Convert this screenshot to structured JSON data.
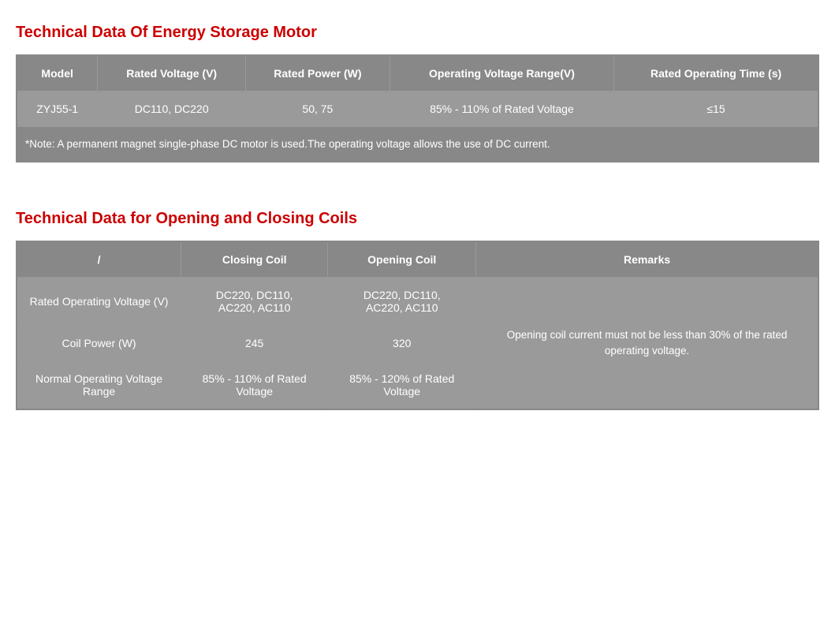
{
  "section1": {
    "title": "Technical Data Of Energy Storage Motor",
    "table": {
      "headers": [
        "Model",
        "Rated Voltage (V)",
        "Rated Power (W)",
        "Operating Voltage Range(V)",
        "Rated Operating Time (s)"
      ],
      "rows": [
        [
          "ZYJ55-1",
          "DC110, DC220",
          "50, 75",
          "85% - 110% of Rated Voltage",
          "≤15"
        ]
      ],
      "note": "*Note: A permanent magnet single-phase DC motor is used.The operating voltage allows the use of DC current."
    }
  },
  "section2": {
    "title": "Technical Data for Opening and Closing Coils",
    "table": {
      "headers": [
        "/",
        "Closing Coil",
        "Opening Coil",
        "Remarks"
      ],
      "rows": [
        {
          "label": "Rated Operating Voltage (V)",
          "closing": "DC220, DC110,\nAC220, AC110",
          "opening": "DC220, DC110,\nAC220, AC110",
          "remarks": "Opening coil current must not be less than 30% of the rated operating voltage."
        },
        {
          "label": "Coil Power (W)",
          "closing": "245",
          "opening": "320",
          "remarks": ""
        },
        {
          "label": "Normal Operating Voltage Range",
          "closing": "85% - 110% of Rated Voltage",
          "opening": "85% - 120% of Rated Voltage",
          "remarks": ""
        }
      ]
    }
  }
}
